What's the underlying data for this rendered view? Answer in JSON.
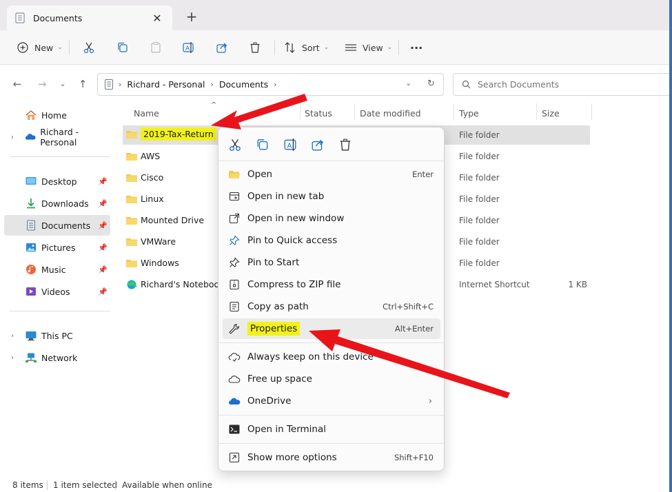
{
  "tab": {
    "title": "Documents",
    "close": "✕",
    "new": "+"
  },
  "toolbar": {
    "new_label": "New",
    "sort_label": "Sort",
    "view_label": "View",
    "more": "···"
  },
  "address": {
    "segments": [
      "Richard - Personal",
      "Documents"
    ],
    "search_placeholder": "Search Documents"
  },
  "sidebar": {
    "items": [
      {
        "label": "Home",
        "icon": "home-icon"
      },
      {
        "label": "Richard - Personal",
        "icon": "onedrive-icon"
      },
      {
        "label": "Desktop",
        "icon": "desktop-icon"
      },
      {
        "label": "Downloads",
        "icon": "download-icon"
      },
      {
        "label": "Documents",
        "icon": "documents-icon"
      },
      {
        "label": "Pictures",
        "icon": "pictures-icon"
      },
      {
        "label": "Music",
        "icon": "music-icon"
      },
      {
        "label": "Videos",
        "icon": "videos-icon"
      },
      {
        "label": "This PC",
        "icon": "pc-icon"
      },
      {
        "label": "Network",
        "icon": "network-icon"
      }
    ]
  },
  "columns": {
    "name": "Name",
    "status": "Status",
    "date": "Date modified",
    "type": "Type",
    "size": "Size"
  },
  "files": [
    {
      "name": "2019-Tax-Return",
      "type": "File folder",
      "size": ""
    },
    {
      "name": "AWS",
      "type": "File folder",
      "size": ""
    },
    {
      "name": "Cisco",
      "type": "File folder",
      "size": ""
    },
    {
      "name": "Linux",
      "type": "File folder",
      "size": ""
    },
    {
      "name": "Mounted Drive",
      "type": "File folder",
      "size": ""
    },
    {
      "name": "VMWare",
      "type": "File folder",
      "size": ""
    },
    {
      "name": "Windows",
      "type": "File folder",
      "size": ""
    },
    {
      "name": "Richard's Notebook",
      "type": "Internet Shortcut",
      "size": "1 KB"
    }
  ],
  "status": {
    "count": "8 items",
    "selected": "1 item selected",
    "availability": "Available when online"
  },
  "menu": {
    "items": [
      {
        "label": "Open",
        "shortcut": "Enter"
      },
      {
        "label": "Open in new tab",
        "shortcut": ""
      },
      {
        "label": "Open in new window",
        "shortcut": ""
      },
      {
        "label": "Pin to Quick access",
        "shortcut": ""
      },
      {
        "label": "Pin to Start",
        "shortcut": ""
      },
      {
        "label": "Compress to ZIP file",
        "shortcut": ""
      },
      {
        "label": "Copy as path",
        "shortcut": "Ctrl+Shift+C"
      },
      {
        "label": "Properties",
        "shortcut": "Alt+Enter"
      },
      {
        "label": "Always keep on this device",
        "shortcut": ""
      },
      {
        "label": "Free up space",
        "shortcut": ""
      },
      {
        "label": "OneDrive",
        "shortcut": ""
      },
      {
        "label": "Open in Terminal",
        "shortcut": ""
      },
      {
        "label": "Show more options",
        "shortcut": "Shift+F10"
      }
    ]
  },
  "colors": {
    "highlight": "#f2f21a",
    "arrow": "#e8141a",
    "folder": "#f2c94c",
    "selection": "#cce8ff"
  }
}
